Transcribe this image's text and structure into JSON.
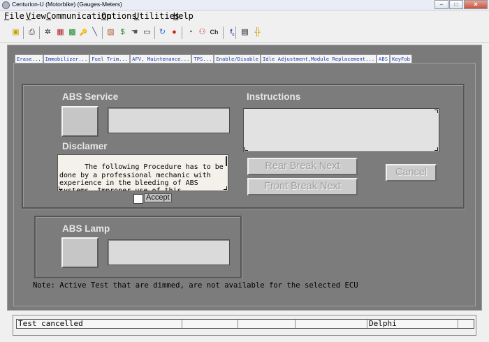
{
  "window": {
    "title": "Centurion-U (Motorbike) (Gauges-Meters)",
    "minimize": "–",
    "maximize": "□",
    "close": "✕"
  },
  "menu": [
    "File",
    "View",
    "Communication",
    "Options",
    "Utilities",
    "Help"
  ],
  "toolbar": {
    "icons": [
      {
        "name": "connect-icon",
        "glyph": "▣",
        "color": "#c9a000"
      },
      {
        "name": "print-icon",
        "glyph": "⎙",
        "color": "#333"
      },
      {
        "name": "scan-icon",
        "glyph": "✲",
        "color": "#333"
      },
      {
        "name": "graph-icon",
        "glyph": "▦",
        "color": "#b02020"
      },
      {
        "name": "modules-icon",
        "glyph": "▩",
        "color": "#1a8a2a"
      },
      {
        "name": "key-icon",
        "glyph": "🔑",
        "color": "#333"
      },
      {
        "name": "tool-icon",
        "glyph": "╲",
        "color": "#2a4aa0"
      },
      {
        "name": "engine-icon",
        "glyph": "▨",
        "color": "#b06030"
      },
      {
        "name": "dollar-icon",
        "glyph": "$",
        "color": "#1a8a2a"
      },
      {
        "name": "hand-icon",
        "glyph": "☚",
        "color": "#555"
      },
      {
        "name": "battery-icon",
        "glyph": "▭",
        "color": "#111"
      },
      {
        "name": "refresh-icon",
        "glyph": "↻",
        "color": "#2a6ad0"
      },
      {
        "name": "stop-icon",
        "glyph": "●",
        "color": "#d02020"
      },
      {
        "name": "car-icon",
        "glyph": "◔",
        "color": "#444"
      },
      {
        "name": "motorbike-icon",
        "glyph": "⚇",
        "color": "#c02020"
      },
      {
        "name": "ch-icon",
        "glyph": "Ch",
        "color": "#333"
      },
      {
        "name": "calculator-icon",
        "glyph": "▤",
        "color": "#111"
      },
      {
        "name": "network-icon",
        "glyph": "╬",
        "color": "#c9a000"
      }
    ]
  },
  "tabs": [
    {
      "label": "Erase...",
      "active": false
    },
    {
      "label": "Immobilizer...",
      "active": false
    },
    {
      "label": "Fuel Trim...",
      "active": false
    },
    {
      "label": "AFV, Maintenance...",
      "active": false
    },
    {
      "label": "TPS...",
      "active": false
    },
    {
      "label": "Enable/Disable",
      "active": false
    },
    {
      "label": "Idle Adjustment,Module Replacement...",
      "active": false
    },
    {
      "label": "ABS",
      "active": true
    },
    {
      "label": "KeyFob",
      "active": false
    }
  ],
  "abs_service": {
    "title": "ABS Service"
  },
  "instructions": {
    "title": "Instructions"
  },
  "disclaimer": {
    "title": "Disclamer",
    "text": "The following Procedure has to be done by a professional mechanic with experience in the bleeding of ABS systems. Improper use of this",
    "accept_label": "Accept"
  },
  "buttons": {
    "rear": "Rear Break Next",
    "front": "Front Break Next",
    "cancel": "Cancel"
  },
  "abs_lamp": {
    "title": "ABS Lamp"
  },
  "note": "Note: Active Test that are dimmed, are not available for the selected ECU",
  "status": [
    "Test cancelled",
    "",
    "",
    "",
    "Delphi",
    ""
  ]
}
